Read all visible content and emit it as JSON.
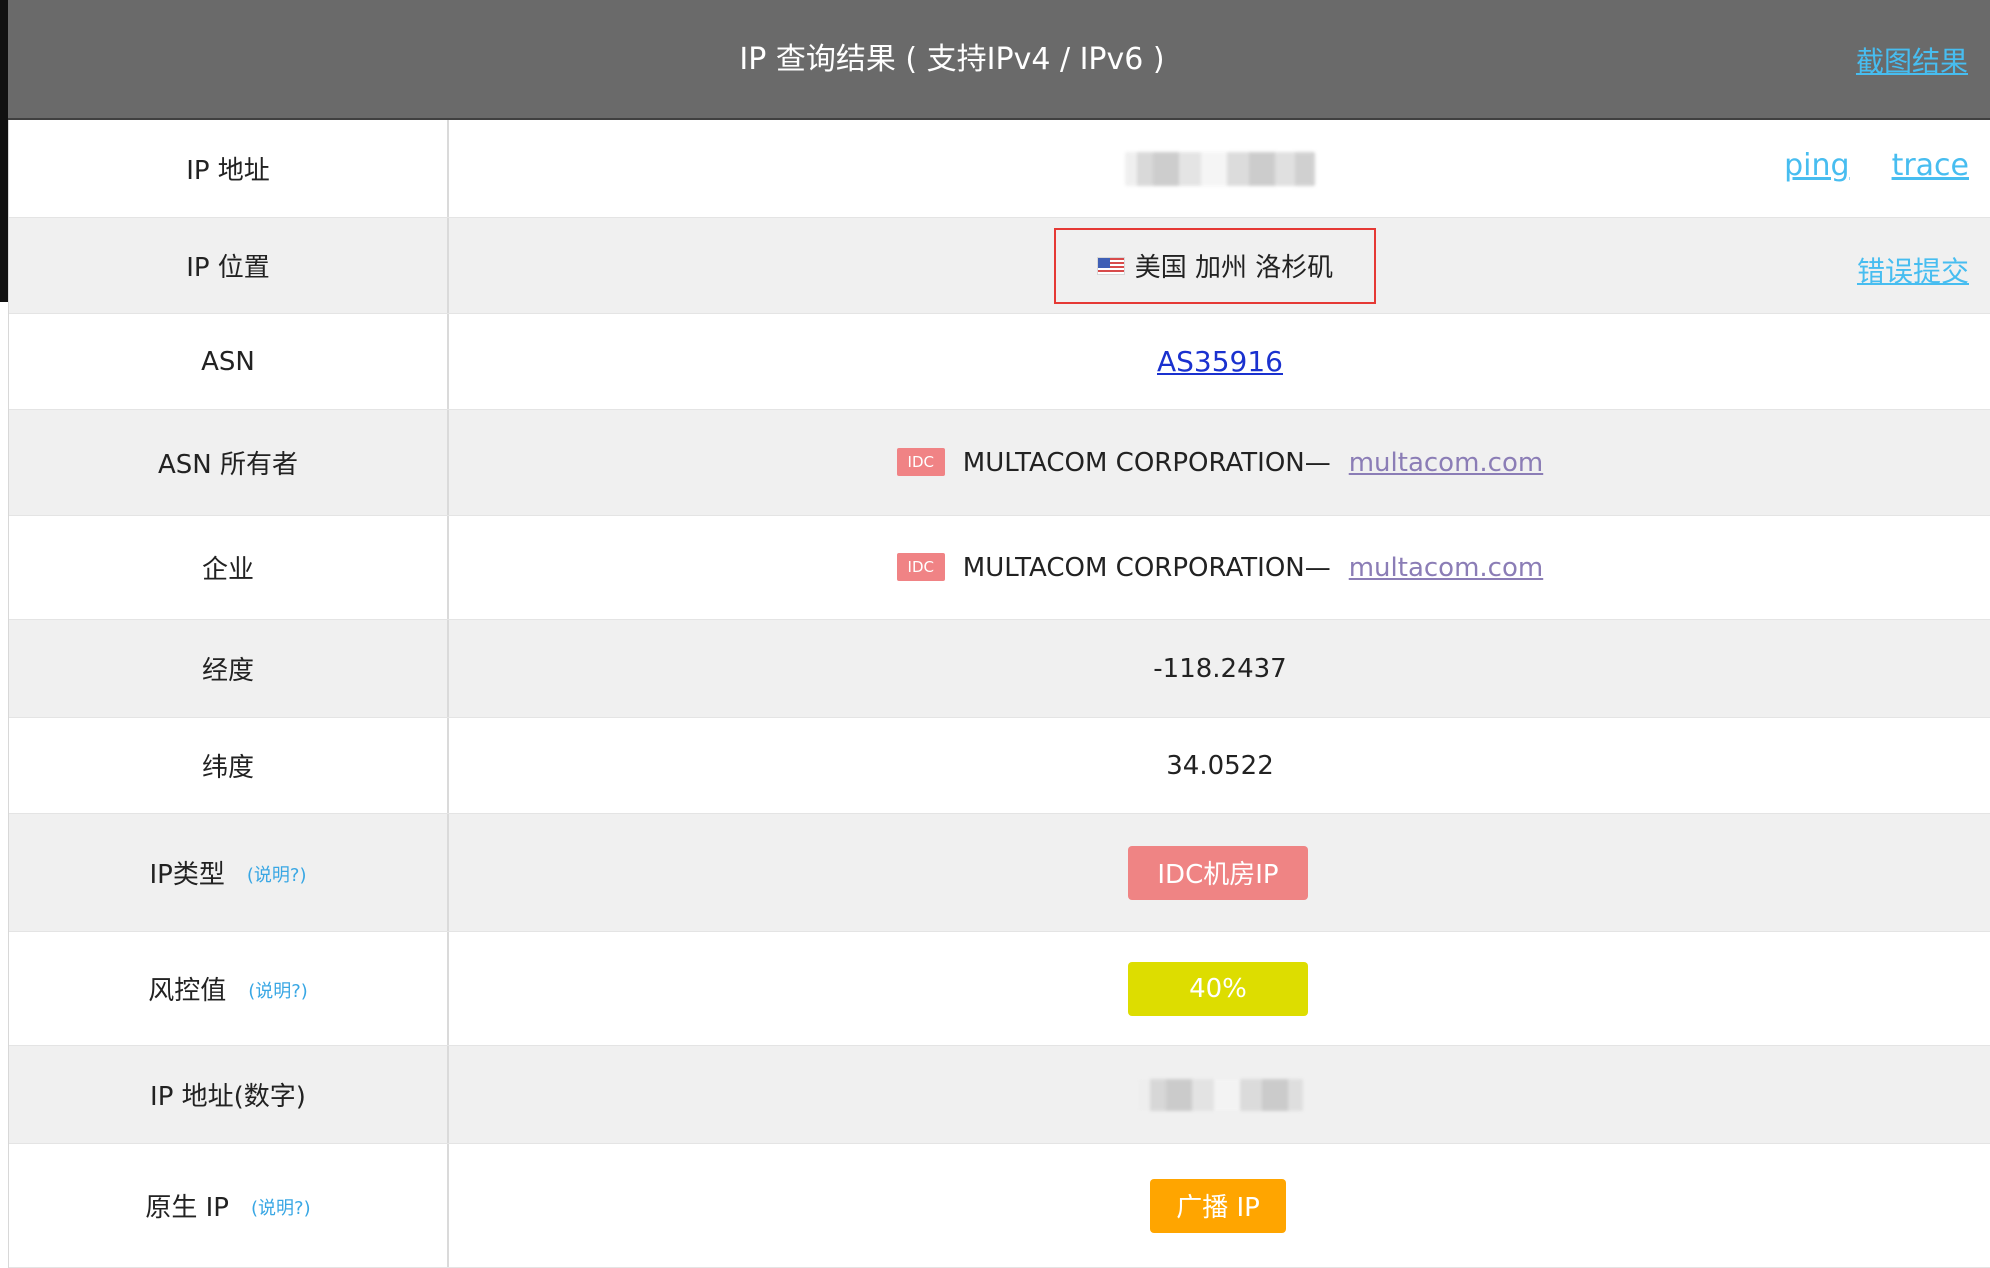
{
  "header": {
    "title": "IP 查询结果 ( 支持IPv4 / IPv6 )",
    "screenshot_link": "截图结果"
  },
  "rows": [
    {
      "label": "IP 地址",
      "actions": {
        "ping": "ping",
        "trace": "trace"
      }
    },
    {
      "label": "IP 位置",
      "value": "美国 加州 洛杉矶",
      "flag_icon": "us-flag-icon",
      "action": "错误提交"
    },
    {
      "label": "ASN",
      "value": "AS35916"
    },
    {
      "label": "ASN 所有者",
      "badge": "IDC",
      "value": "MULTACOM CORPORATION—",
      "link": "multacom.com"
    },
    {
      "label": "企业",
      "badge": "IDC",
      "value": "MULTACOM CORPORATION—",
      "link": "multacom.com"
    },
    {
      "label": "经度",
      "value": "-118.2437"
    },
    {
      "label": "纬度",
      "value": "34.0522"
    },
    {
      "label": "IP类型",
      "help": "(说明?)",
      "value": "IDC机房IP",
      "color": "#ef8484"
    },
    {
      "label": "风控值",
      "help": "(说明?)",
      "value": "40%",
      "risk_value": 40,
      "color": "#dddd00"
    },
    {
      "label": "IP 地址(数字)"
    },
    {
      "label": "原生 IP",
      "help": "(说明?)",
      "value": "广播 IP",
      "color": "#ffa500"
    }
  ],
  "colors": {
    "header_bg": "#6a6a6a",
    "link": "#47bdf0",
    "alt_row_bg": "#f0f0f0",
    "highlight_border": "#e53935",
    "asn_link": "#1a31cf",
    "company_link": "#8b7db6"
  }
}
